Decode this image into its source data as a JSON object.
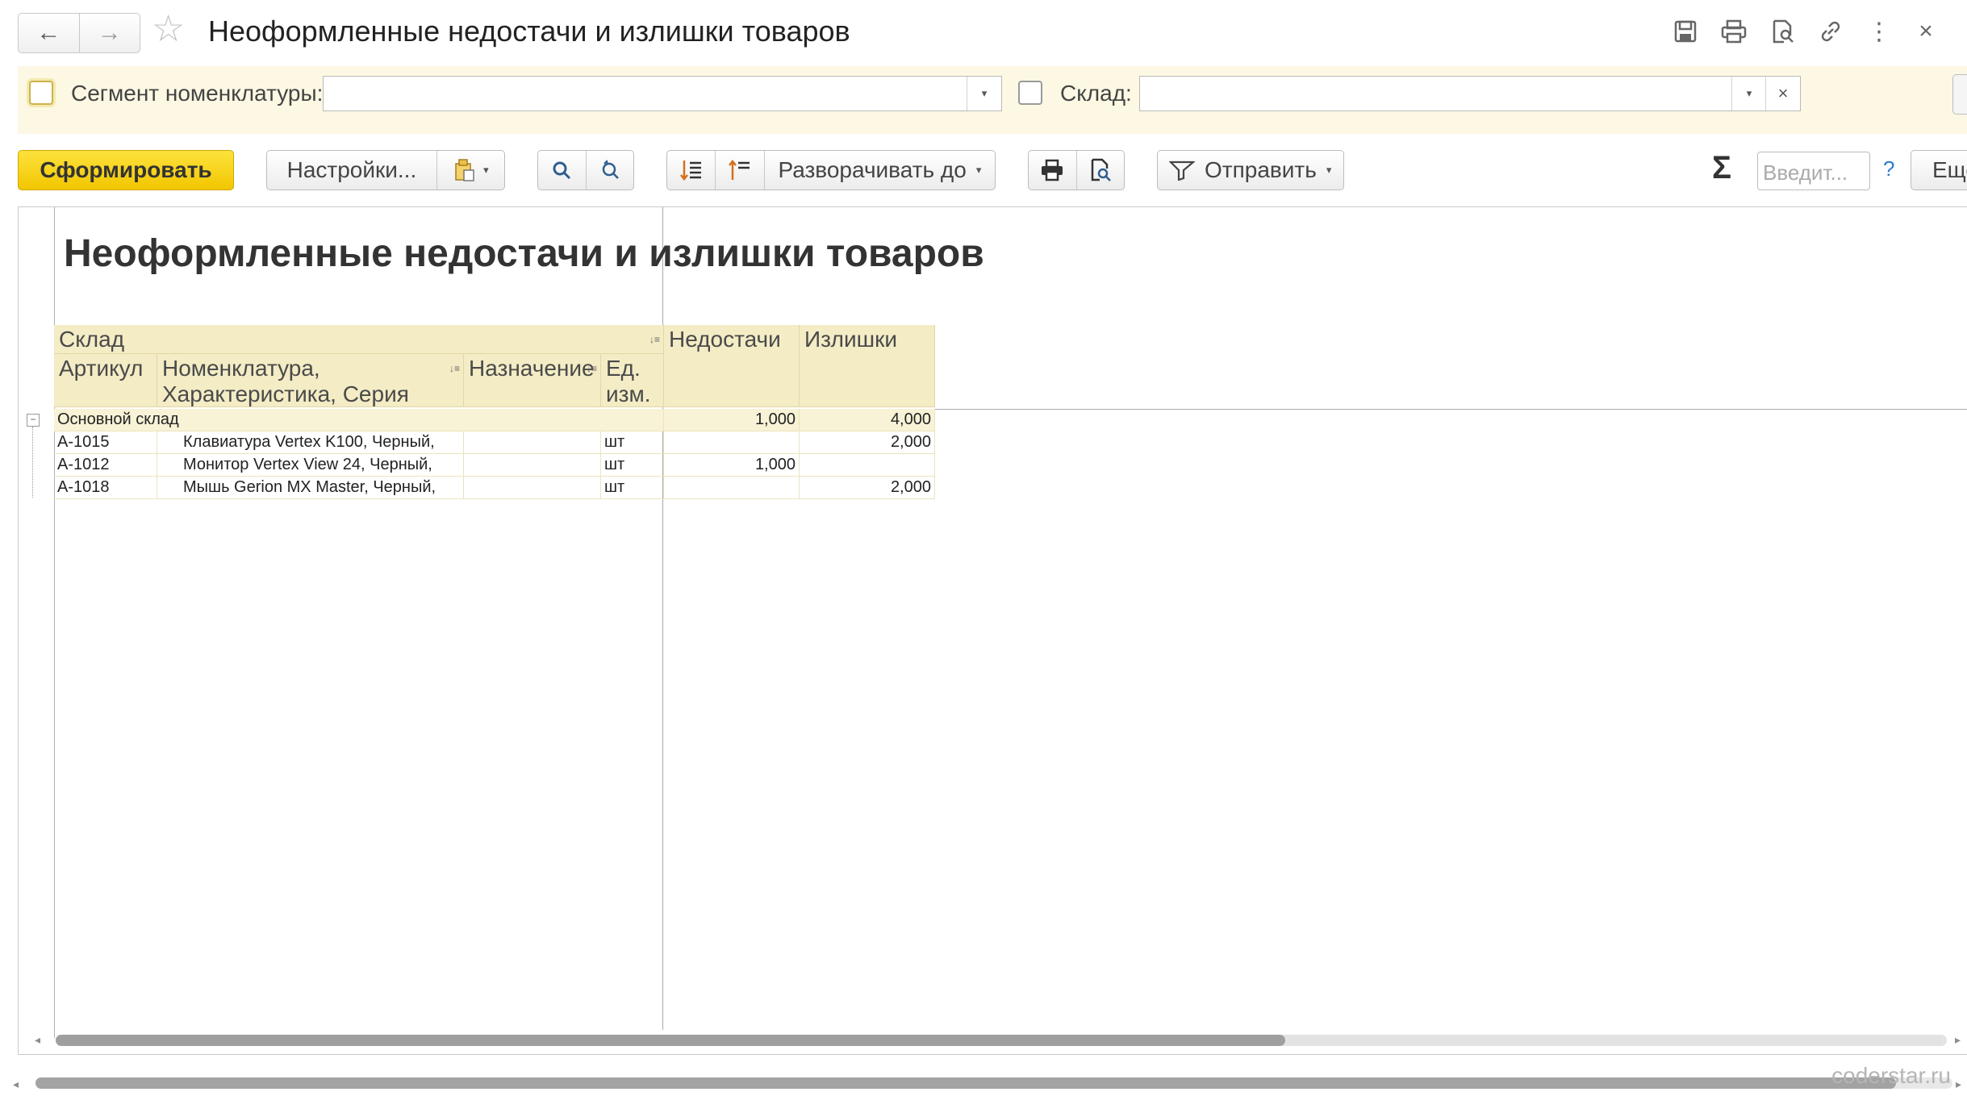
{
  "window": {
    "title": "Неоформленные недостачи и излишки товаров",
    "back_icon": "←",
    "forward_icon": "→",
    "star_icon": "☆",
    "toolbar_icons": [
      "save-icon",
      "print-icon",
      "preview-icon",
      "link-icon",
      "more-icon",
      "close-icon"
    ],
    "close_icon": "×",
    "more_icon": "⋮"
  },
  "filters": {
    "segment_label": "Сегмент номенклатуры:",
    "segment_value": "",
    "warehouse_label": "Склад:",
    "warehouse_value": "",
    "dropdown_icon": "▾",
    "clear_icon": "×"
  },
  "toolbar": {
    "generate": "Сформировать",
    "settings": "Настройки...",
    "expand_to": "Разворачивать до",
    "send": "Отправить",
    "more": "Еще",
    "sigma": "Σ",
    "search_placeholder": "Введит...",
    "help": "?",
    "caret": "▾"
  },
  "report": {
    "title": "Неоформленные недостачи и излишки товаров",
    "headers": {
      "warehouse": "Склад",
      "article": "Артикул",
      "nomenclature": "Номенклатура, Характеристика, Серия",
      "purpose": "Назначение",
      "unit": "Ед. изм.",
      "shortages": "Недостачи",
      "surpluses": "Излишки"
    },
    "group": {
      "name": "Основной склад",
      "shortages": "1,000",
      "surpluses": "4,000",
      "toggle": "−"
    },
    "rows": [
      {
        "article": "А-1015",
        "name": "Клавиатура Vertex K100, Черный,",
        "purpose": "",
        "unit": "шт",
        "shortages": "",
        "surpluses": "2,000"
      },
      {
        "article": "А-1012",
        "name": "Монитор Vertex View 24, Черный,",
        "purpose": "",
        "unit": "шт",
        "shortages": "1,000",
        "surpluses": ""
      },
      {
        "article": "А-1018",
        "name": "Мышь Gerion MX Master, Черный,",
        "purpose": "",
        "unit": "шт",
        "shortages": "",
        "surpluses": "2,000"
      }
    ]
  },
  "scroll": {
    "inner_thumb_fraction": 0.65,
    "left_arrow": "◂",
    "right_arrow": "▸"
  },
  "watermark": "coderstar.ru"
}
